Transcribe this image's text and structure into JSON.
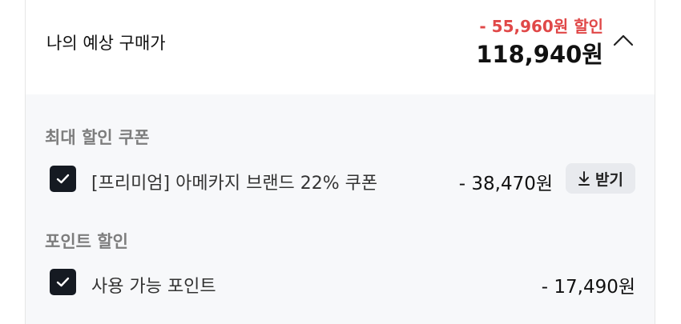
{
  "summary": {
    "label": "나의 예상 구매가",
    "discount_total": "- 55,960원 할인",
    "final_price": "118,940원"
  },
  "coupon_section": {
    "title": "최대 할인 쿠폰",
    "item": {
      "checked": true,
      "label": "[프리미엄] 아메카지 브랜드 22% 쿠폰",
      "amount": "- 38,470원",
      "button_label": "받기"
    }
  },
  "point_section": {
    "title": "포인트 할인",
    "item": {
      "checked": true,
      "label": "사용 가능 포인트",
      "amount": "- 17,490원"
    }
  },
  "colors": {
    "discount_red": "#e04848",
    "checkbox_dark": "#151a22",
    "section_bg": "#f7f8fa",
    "button_bg": "#e8eaee"
  },
  "icons": [
    "chevron-up-icon",
    "check-icon",
    "download-icon"
  ]
}
